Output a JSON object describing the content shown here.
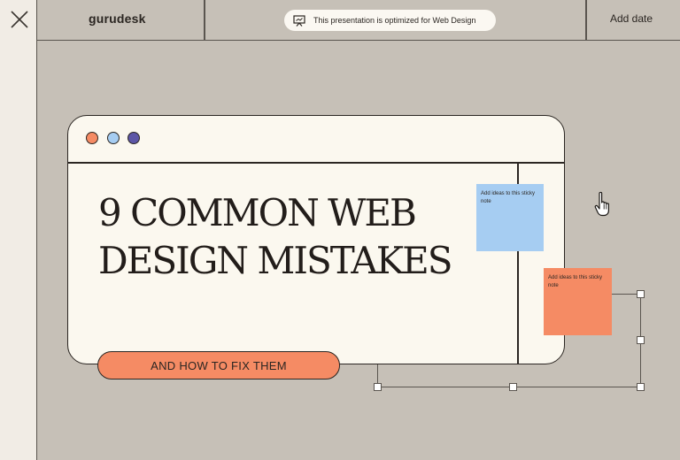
{
  "app": {
    "logo_text": "gurudesk"
  },
  "topbar": {
    "notice_text": "This presentation is optimized for Web Design",
    "notice_icon": "presentation-icon",
    "add_date_label": "Add date"
  },
  "left_rail": {
    "close_icon": "close-icon"
  },
  "slide": {
    "headline_line1": "9 COMMON WEB",
    "headline_line2": "DESIGN MISTAKES",
    "cta_label": "AND HOW TO FIX THEM",
    "window_dots": [
      "#f58b64",
      "#a6cdf2",
      "#5c56a6"
    ],
    "sticky_notes": [
      {
        "text": "Add ideas to this sticky note",
        "color": "#a6cdf2"
      },
      {
        "text": "Add ideas to this sticky note",
        "color": "#f58b64"
      }
    ]
  },
  "colors": {
    "background": "#c6c0b7",
    "panel": "#f1ece5",
    "window": "#fbf8ef",
    "accent_orange": "#f58b64",
    "accent_blue": "#a6cdf2",
    "accent_purple": "#5c56a6",
    "ink": "#2b2622"
  },
  "cursor_icon": "hand-pointer-icon"
}
